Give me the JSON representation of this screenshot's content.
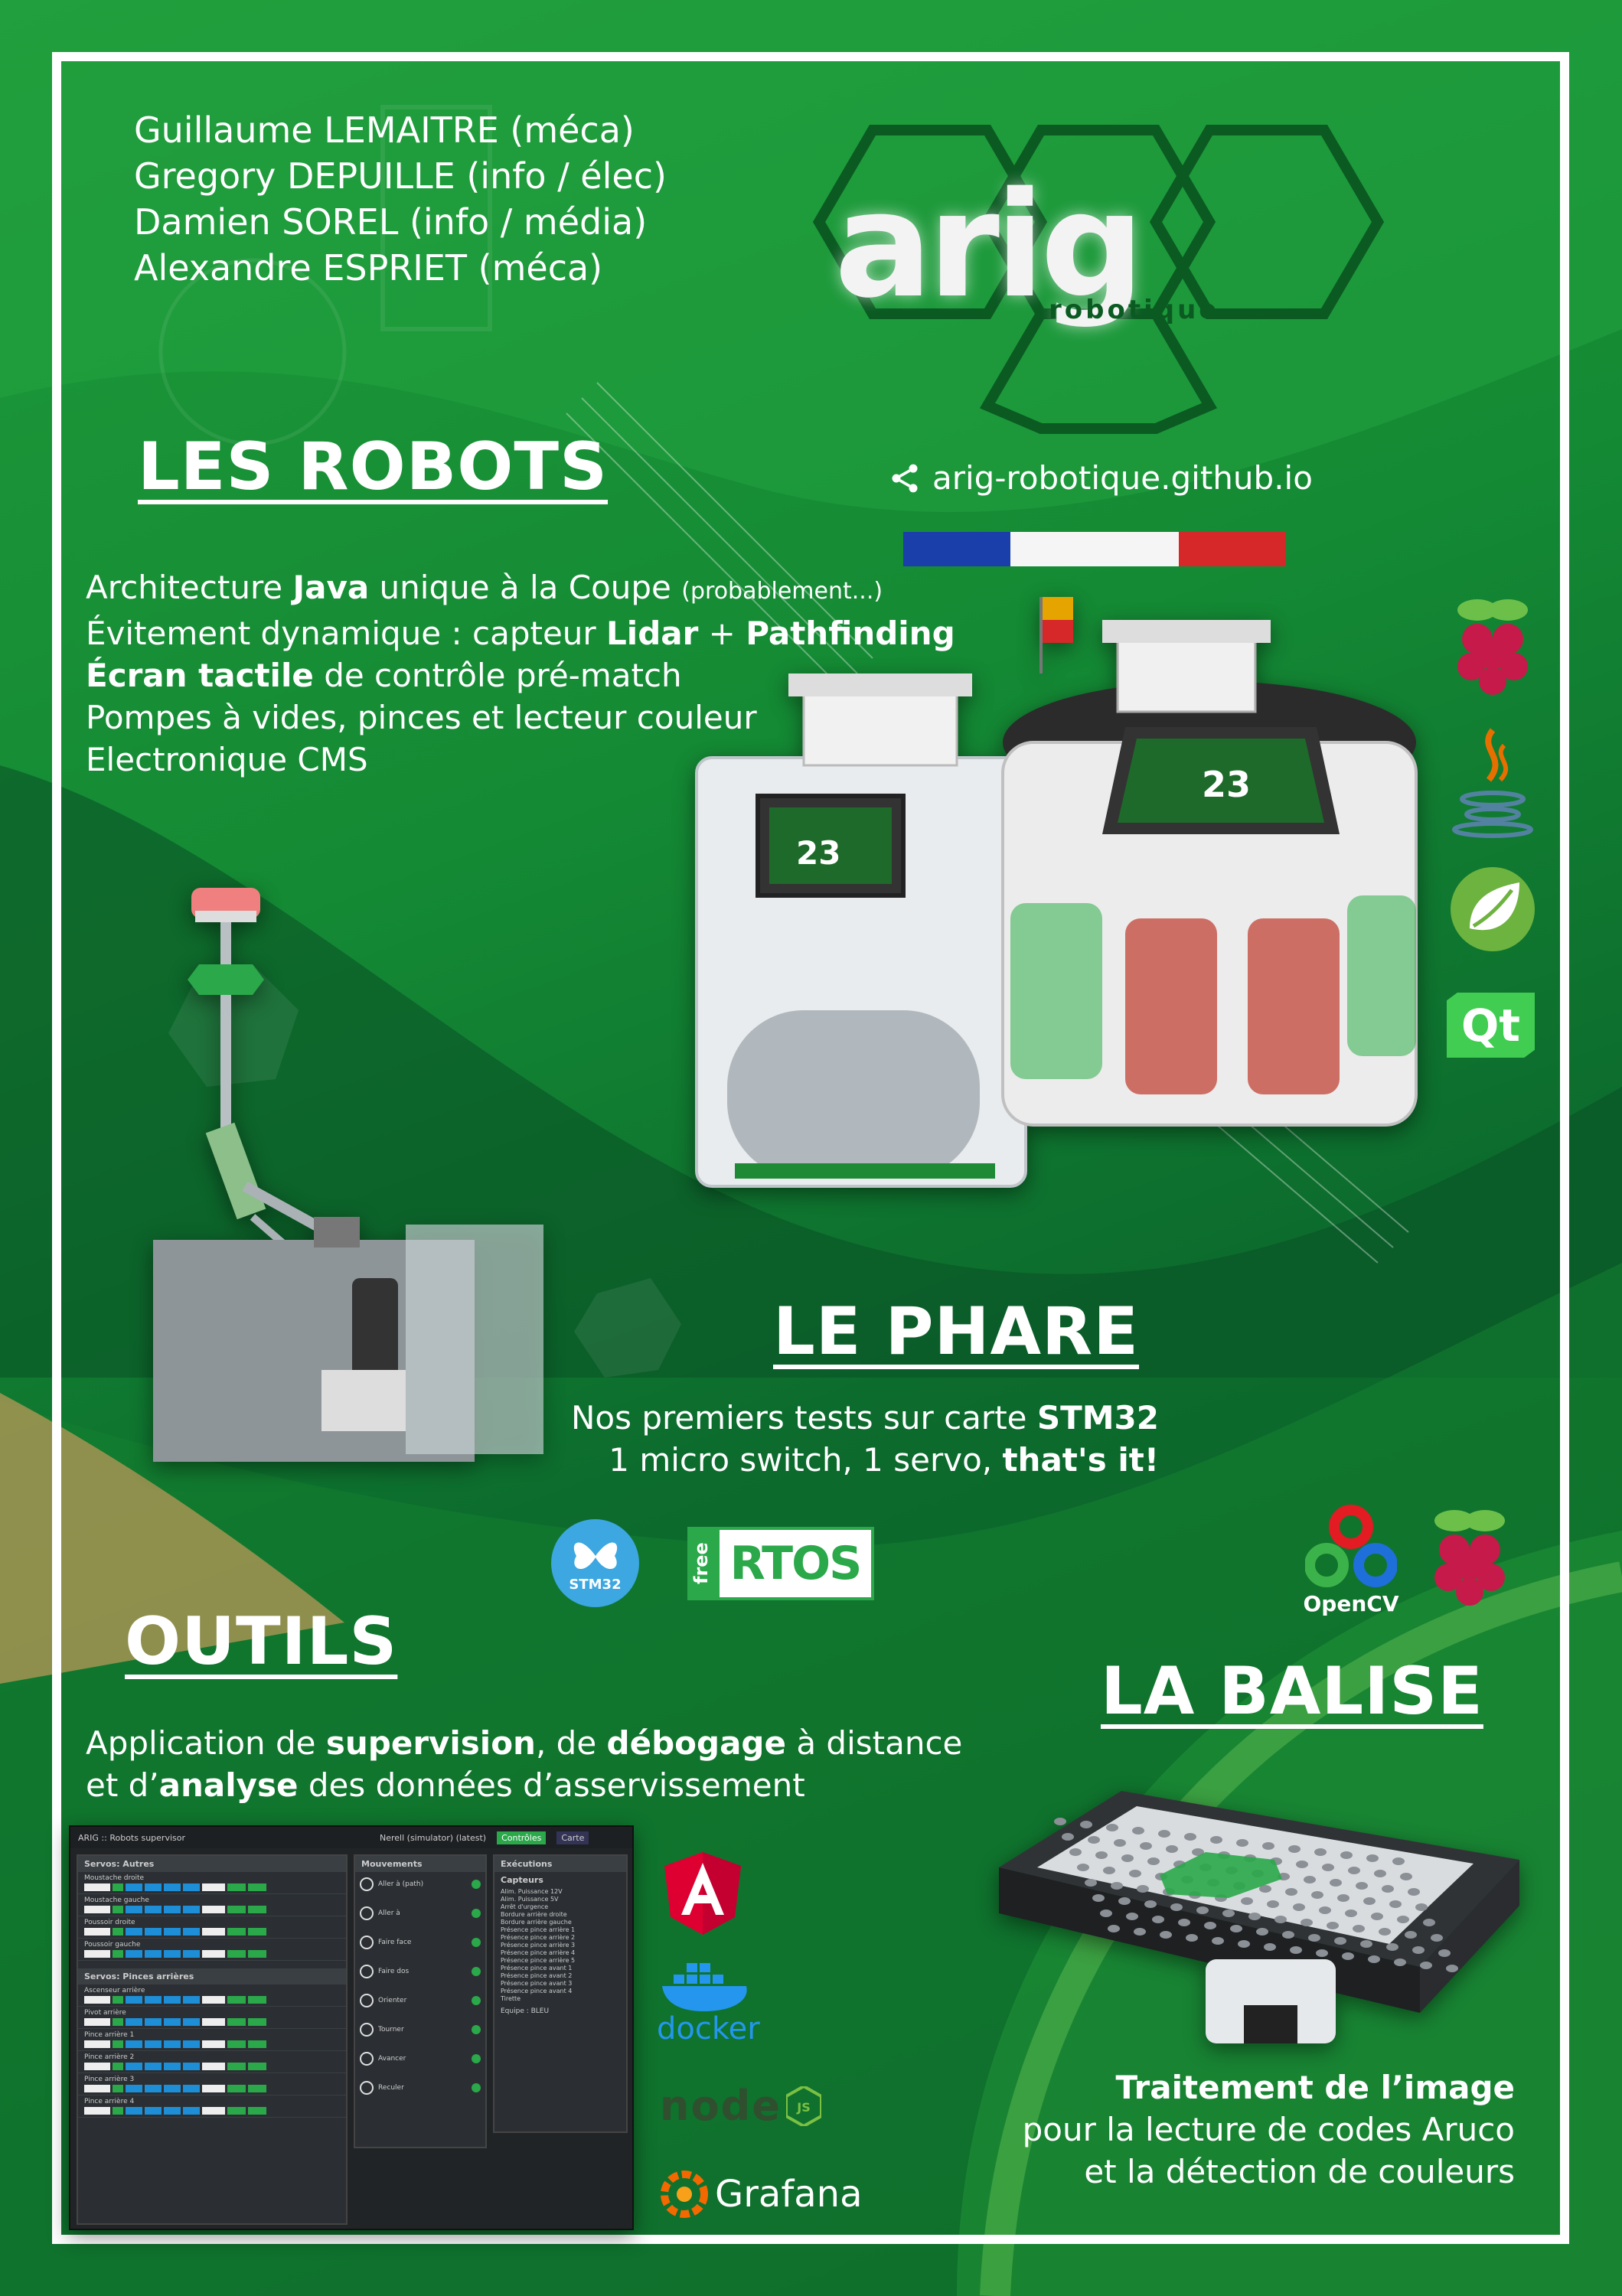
{
  "authors": [
    "Guillaume LEMAITRE  (méca)",
    "Gregory DEPUILLE  (info / élec)",
    "Damien SOREL  (info / média)",
    "Alexandre ESPRIET  (méca)"
  ],
  "logo": {
    "main": "arig",
    "sub": "robotique"
  },
  "website": "arig-robotique.github.io",
  "robots": {
    "title": "LES ROBOTS",
    "lines": [
      {
        "pre": "Architecture ",
        "bold": "Java",
        "post": " unique à la Coupe ",
        "small": "(probablement...)"
      },
      {
        "pre": "Évitement dynamique : capteur ",
        "bold": "Lidar",
        "mid": " + ",
        "bold2": "Pathfinding"
      },
      {
        "bold": "Écran tactile",
        "post": " de contrôle pré-match"
      },
      {
        "pre": "Pompes à vides, pinces et lecteur couleur"
      },
      {
        "pre": "Electronique CMS"
      }
    ],
    "screen_number": "23",
    "icons": [
      "raspberry-pi-icon",
      "java-icon",
      "spring-icon",
      "qt-icon"
    ],
    "qt_label": "Qt"
  },
  "phare": {
    "title": "LE PHARE",
    "line1_pre": "Nos premiers tests sur carte ",
    "line1_bold": "STM32",
    "line2_pre": "1 micro switch, 1 servo, ",
    "line2_bold": "that's it!",
    "stm32_label": "STM32",
    "freertos_free": "free",
    "freertos_rtos": "RTOS"
  },
  "outils": {
    "title": "OUTILS",
    "line1": {
      "pre": "Application de ",
      "b1": "supervision",
      "mid": ", de ",
      "b2": "débogage",
      "post": " à distance"
    },
    "line2": {
      "pre": "et d’",
      "b1": "analyse",
      "post": " des données d’asservissement"
    },
    "app": {
      "brand": "ARIG :: Robots supervisor",
      "robot": "Nerell (simulator) (latest)",
      "tab1": "Contrôles",
      "tab2": "Carte",
      "col1_title": "Servos: Autres",
      "col1b_title": "Servos: Pinces arrières",
      "col2_title": "Mouvements",
      "col2_items": [
        "Aller à (path)",
        "Aller à",
        "Faire face",
        "Faire dos",
        "Orienter",
        "Tourner",
        "Avancer",
        "Reculer"
      ],
      "col3_title": "Exécutions",
      "col3_sub": "Capteurs",
      "col3_footer": "Equipe : BLEU",
      "servo_rows": [
        "Moustache droite",
        "Moustache gauche",
        "Poussoir droite",
        "Poussoir gauche"
      ],
      "pince_rows": [
        "Ascenseur arrière",
        "Pivot arrière",
        "Pince arrière 1",
        "Pince arrière 2",
        "Pince arrière 3",
        "Pince arrière 4"
      ],
      "sensor_rows": [
        "Alim. Puissance 12V",
        "Alim. Puissance 5V",
        "Arrêt d'urgence",
        "Bordure arrière droite",
        "Bordure arrière gauche",
        "Présence pince arrière 1",
        "Présence pince arrière 2",
        "Présence pince arrière 3",
        "Présence pince arrière 4",
        "Présence pince arrière 5",
        "Présence pince avant 1",
        "Présence pince avant 2",
        "Présence pince avant 3",
        "Présence pince avant 4",
        "Tirette"
      ]
    },
    "icons": [
      "angular-icon",
      "docker-icon",
      "nodejs-icon",
      "grafana-icon"
    ],
    "docker_label": "docker",
    "node_label": "node",
    "grafana_label": "Grafana"
  },
  "balise": {
    "title": "LA BALISE",
    "line1": "Traitement de l’image",
    "line2": "pour la lecture de codes Aruco",
    "line3": "et la détection de couleurs",
    "opencv_label": "OpenCV"
  },
  "colors": {
    "green": "#1f9a3a",
    "dark_green": "#0a5a28",
    "white": "#ffffff",
    "accent": "#2ecc40"
  }
}
